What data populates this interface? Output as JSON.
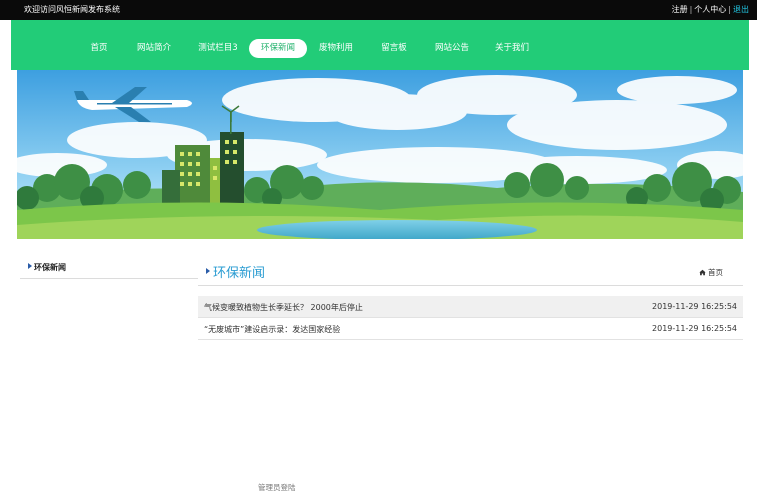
{
  "topbar": {
    "welcome": "欢迎访问风恒新闻发布系统",
    "register": "注册",
    "separator": "|",
    "user_center": "个人中心",
    "logout": "退出"
  },
  "nav": {
    "items": [
      {
        "label": "首页"
      },
      {
        "label": "网站简介"
      },
      {
        "label": "测试栏目3"
      },
      {
        "label": "环保新闻",
        "active": true
      },
      {
        "label": "废物利用"
      },
      {
        "label": "留言板"
      },
      {
        "label": "网站公告"
      },
      {
        "label": "关于我们"
      }
    ]
  },
  "sidebar": {
    "title": "环保新闻"
  },
  "main": {
    "title": "环保新闻",
    "home_icon": "home-icon",
    "breadcrumb_home": "首页",
    "news": [
      {
        "title": "气候变暖致植物生长季延长？ 2000年后停止",
        "date": "2019-11-29 16:25:54"
      },
      {
        "title": "“无废城市”建设启示录：发达国家经验",
        "date": "2019-11-29 16:25:54"
      }
    ]
  },
  "footer": {
    "admin_login": "管理员登陆"
  },
  "colors": {
    "nav_bg": "#22cc78",
    "topbar_bg": "#0a0a0a",
    "title_blue": "#2a9cd2",
    "logout_cyan": "#22c4e0"
  }
}
